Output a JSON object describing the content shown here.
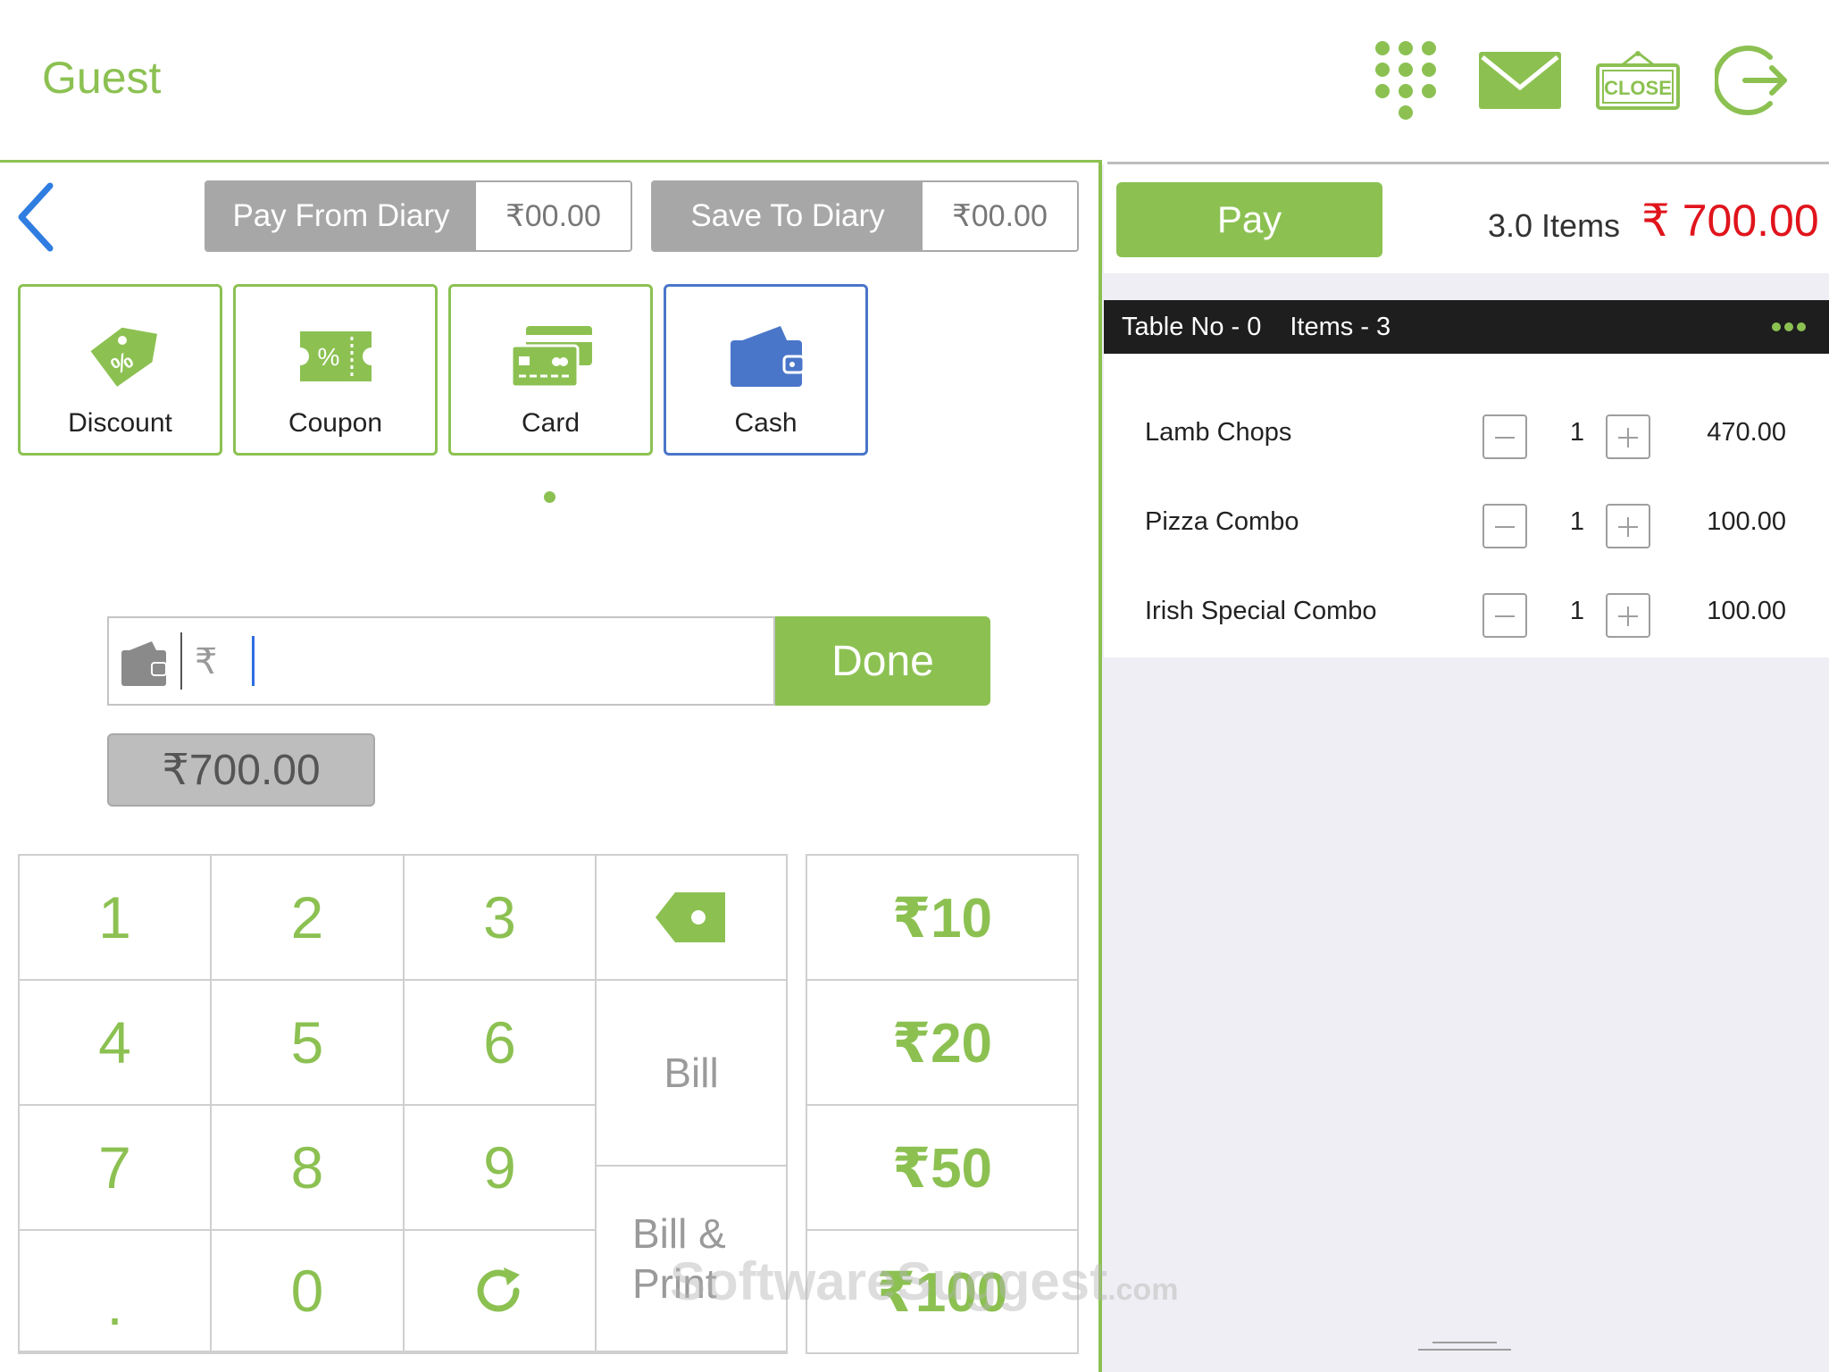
{
  "header": {
    "title": "Guest",
    "icons": [
      "keypad-dots-icon",
      "mail-icon",
      "close-sign-icon",
      "logout-icon"
    ],
    "close_sign_text": "CLOSE"
  },
  "colors": {
    "accent": "#8cc152",
    "active_border": "#4a76c9",
    "total_red": "#e0141c",
    "table_bar": "#1e1e1e",
    "right_bg": "#eeeef4"
  },
  "diary": {
    "pay_from_label": "Pay From Diary",
    "pay_from_value": "₹00.00",
    "save_to_label": "Save To Diary",
    "save_to_value": "₹00.00"
  },
  "payment_methods": [
    {
      "label": "Discount",
      "icon": "discount-tag-icon",
      "selected": false
    },
    {
      "label": "Coupon",
      "icon": "coupon-ticket-icon",
      "selected": false
    },
    {
      "label": "Card",
      "icon": "credit-card-icon",
      "selected": false
    },
    {
      "label": "Cash",
      "icon": "wallet-icon",
      "selected": true
    }
  ],
  "amount_input": {
    "currency_symbol": "₹",
    "value": "",
    "done_label": "Done"
  },
  "total_chip": "₹700.00",
  "keypad": {
    "digits": [
      "1",
      "2",
      "3",
      "4",
      "5",
      "6",
      "7",
      "8",
      "9",
      ".",
      "0"
    ],
    "bill_label": "Bill",
    "bill_print_label": "Bill & Print"
  },
  "quick_amounts": [
    "₹10",
    "₹20",
    "₹50",
    "₹100"
  ],
  "watermark": {
    "main": "SoftwareSuggest",
    "suffix": ".com"
  },
  "order": {
    "pay_label": "Pay",
    "items_count": "3.0 Items",
    "total": "₹ 700.00",
    "table_no": "Table No - 0",
    "items_label": "Items - 3",
    "items": [
      {
        "name": "Lamb Chops",
        "qty": "1",
        "price": "470.00"
      },
      {
        "name": "Pizza Combo",
        "qty": "1",
        "price": "100.00"
      },
      {
        "name": "Irish Special Combo",
        "qty": "1",
        "price": "100.00"
      }
    ]
  }
}
